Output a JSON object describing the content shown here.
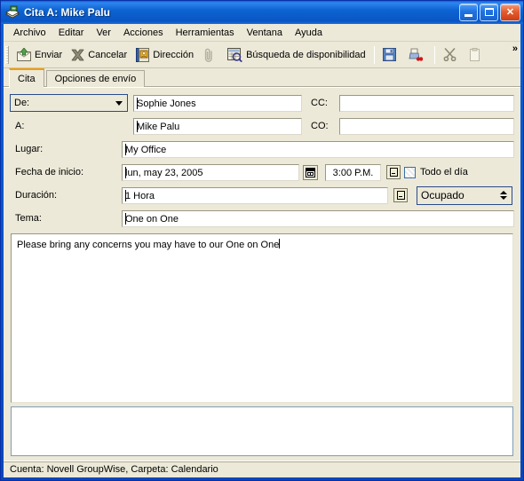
{
  "window": {
    "title": "Cita A:  Mike Palu",
    "icon": "appointment-icon",
    "buttons": {
      "minimize": "_",
      "maximize": "□",
      "close": "✕"
    }
  },
  "menubar": {
    "items": [
      {
        "label": "Archivo"
      },
      {
        "label": "Editar"
      },
      {
        "label": "Ver"
      },
      {
        "label": "Acciones"
      },
      {
        "label": "Herramientas"
      },
      {
        "label": "Ventana"
      },
      {
        "label": "Ayuda"
      }
    ]
  },
  "toolbar": {
    "send_label": "Enviar",
    "cancel_label": "Cancelar",
    "address_label": "Dirección",
    "attach_label": "",
    "busysearch_label": "Búsqueda de disponibilidad",
    "save_label": "",
    "print_label": "",
    "cut_label": "",
    "paste_label": "",
    "overflow_label": "»"
  },
  "tabs": [
    {
      "label": "Cita",
      "active": true
    },
    {
      "label": "Opciones de envío",
      "active": false
    }
  ],
  "form": {
    "from": {
      "combo_value": "De:",
      "value": "Sophie Jones"
    },
    "to": {
      "label": "A:",
      "value": "Mike Palu"
    },
    "cc": {
      "label": "CC:",
      "value": ""
    },
    "bcc": {
      "label": "CO:",
      "value": ""
    },
    "place": {
      "label": "Lugar:",
      "value": "My Office"
    },
    "start_date": {
      "label": "Fecha de inicio:",
      "value": "lun, may 23, 2005"
    },
    "start_time": {
      "value": "3:00 P.M."
    },
    "all_day": {
      "label": "Todo el día",
      "checked": false
    },
    "duration": {
      "label": "Duración:",
      "value": "1 Hora"
    },
    "availability": {
      "value": "Ocupado"
    },
    "subject": {
      "label": "Tema:",
      "value": "One on One"
    },
    "message": {
      "value": "Please bring any concerns you may have to our One on One"
    },
    "attachments": {
      "value": ""
    }
  },
  "statusbar": {
    "text": "Cuenta: Novell GroupWise,  Carpeta: Calendario"
  },
  "colors": {
    "titlebar_blue": "#0a52c8",
    "face": "#ece9d8",
    "active_tab_accent": "#f59b00",
    "field_border": "#9a9784"
  }
}
